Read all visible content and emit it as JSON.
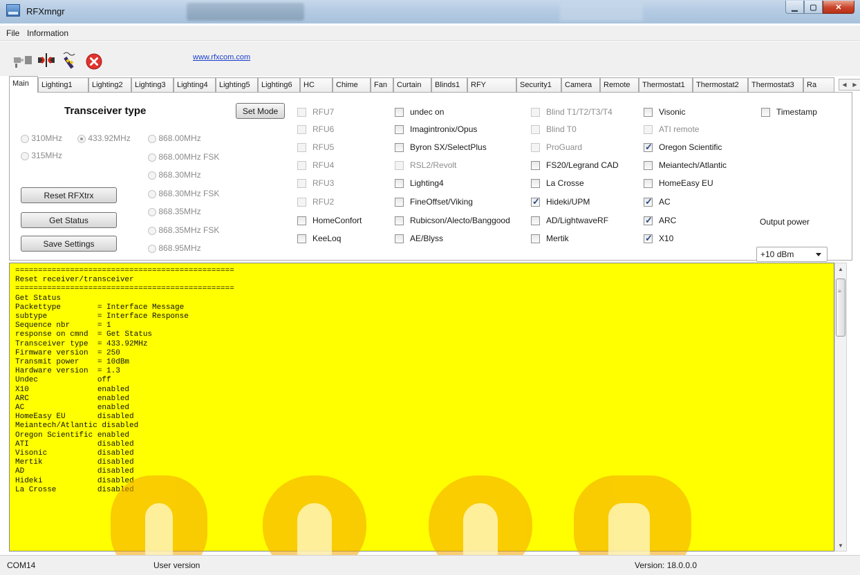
{
  "window": {
    "title": "RFXmngr"
  },
  "menu": {
    "file": "File",
    "information": "Information"
  },
  "toolbar": {
    "link": "www.rfxcom.com",
    "icons": [
      "connect-icon",
      "disconnect-icon",
      "wand-icon",
      "stop-icon"
    ]
  },
  "tabs": [
    "Main",
    "Lighting1",
    "Lighting2",
    "Lighting3",
    "Lighting4",
    "Lighting5",
    "Lighting6",
    "HC",
    "Chime",
    "Fan",
    "Curtain",
    "Blinds1",
    "RFY",
    "Security1",
    "Camera",
    "Remote",
    "Thermostat1",
    "Thermostat2",
    "Thermostat3",
    "Ra"
  ],
  "transceiver": {
    "heading": "Transceiver type",
    "set_mode": "Set Mode",
    "freq_310": "310MHz",
    "freq_433": "433.92MHz",
    "freq_315": "315MHz",
    "freq_868_00": "868.00MHz",
    "freq_868_00_fsk": "868.00MHz FSK",
    "freq_868_30": "868.30MHz",
    "freq_868_30_fsk": "868.30MHz FSK",
    "freq_868_35": "868.35MHz",
    "freq_868_35_fsk": "868.35MHz FSK",
    "freq_868_95": "868.95MHz",
    "selected": "433.92MHz"
  },
  "buttons": {
    "reset": "Reset RFXtrx",
    "status": "Get Status",
    "save": "Save Settings"
  },
  "protocols": {
    "col1": [
      {
        "label": "RFU7",
        "checked": false,
        "disabled": true
      },
      {
        "label": "RFU6",
        "checked": false,
        "disabled": true
      },
      {
        "label": "RFU5",
        "checked": false,
        "disabled": true
      },
      {
        "label": "RFU4",
        "checked": false,
        "disabled": true
      },
      {
        "label": "RFU3",
        "checked": false,
        "disabled": true
      },
      {
        "label": "RFU2",
        "checked": false,
        "disabled": true
      },
      {
        "label": "HomeConfort",
        "checked": false,
        "disabled": false
      },
      {
        "label": "KeeLoq",
        "checked": false,
        "disabled": false
      }
    ],
    "col2": [
      {
        "label": "undec on",
        "checked": false,
        "disabled": false
      },
      {
        "label": "Imagintronix/Opus",
        "checked": false,
        "disabled": false
      },
      {
        "label": "Byron SX/SelectPlus",
        "checked": false,
        "disabled": false
      },
      {
        "label": "RSL2/Revolt",
        "checked": false,
        "disabled": true
      },
      {
        "label": "Lighting4",
        "checked": false,
        "disabled": false
      },
      {
        "label": "FineOffset/Viking",
        "checked": false,
        "disabled": false
      },
      {
        "label": "Rubicson/Alecto/Banggood",
        "checked": false,
        "disabled": false
      },
      {
        "label": "AE/Blyss",
        "checked": false,
        "disabled": false
      }
    ],
    "col3": [
      {
        "label": "Blind T1/T2/T3/T4",
        "checked": false,
        "disabled": true
      },
      {
        "label": "Blind T0",
        "checked": false,
        "disabled": true
      },
      {
        "label": "ProGuard",
        "checked": false,
        "disabled": true
      },
      {
        "label": "FS20/Legrand CAD",
        "checked": false,
        "disabled": false
      },
      {
        "label": "La Crosse",
        "checked": false,
        "disabled": false
      },
      {
        "label": "Hideki/UPM",
        "checked": true,
        "disabled": false
      },
      {
        "label": "AD/LightwaveRF",
        "checked": false,
        "disabled": false
      },
      {
        "label": "Mertik",
        "checked": false,
        "disabled": false
      }
    ],
    "col4": [
      {
        "label": "Visonic",
        "checked": false,
        "disabled": false
      },
      {
        "label": "ATI remote",
        "checked": false,
        "disabled": true
      },
      {
        "label": "Oregon Scientific",
        "checked": true,
        "disabled": false
      },
      {
        "label": "Meiantech/Atlantic",
        "checked": false,
        "disabled": false
      },
      {
        "label": "HomeEasy EU",
        "checked": false,
        "disabled": false
      },
      {
        "label": "AC",
        "checked": true,
        "disabled": false
      },
      {
        "label": "ARC",
        "checked": true,
        "disabled": false
      },
      {
        "label": "X10",
        "checked": true,
        "disabled": false
      }
    ],
    "timestamp": {
      "label": "Timestamp",
      "checked": false
    }
  },
  "output_power": {
    "label": "Output power",
    "value": "+10 dBm"
  },
  "log": {
    "lines": [
      "================================================",
      "Reset receiver/transceiver",
      "================================================",
      "Get Status",
      "Packettype        = Interface Message",
      "subtype           = Interface Response",
      "Sequence nbr      = 1",
      "response on cmnd  = Get Status",
      "Transceiver type  = 433.92MHz",
      "Firmware version  = 250",
      "Transmit power    = 10dBm",
      "Hardware version  = 1.3",
      "Undec             off",
      "X10               enabled",
      "ARC               enabled",
      "AC                enabled",
      "HomeEasy EU       disabled",
      "Meiantech/Atlantic disabled",
      "Oregon Scientific enabled",
      "ATI               disabled",
      "Visonic           disabled",
      "Mertik            disabled",
      "AD                disabled",
      "Hideki            disabled",
      "La Crosse         disabled"
    ]
  },
  "status": {
    "port": "COM14",
    "user": "User version",
    "version": "Version: 18.0.0.0"
  },
  "colors": {
    "log_bg": "#ffff00",
    "link": "#1a3fcc"
  }
}
